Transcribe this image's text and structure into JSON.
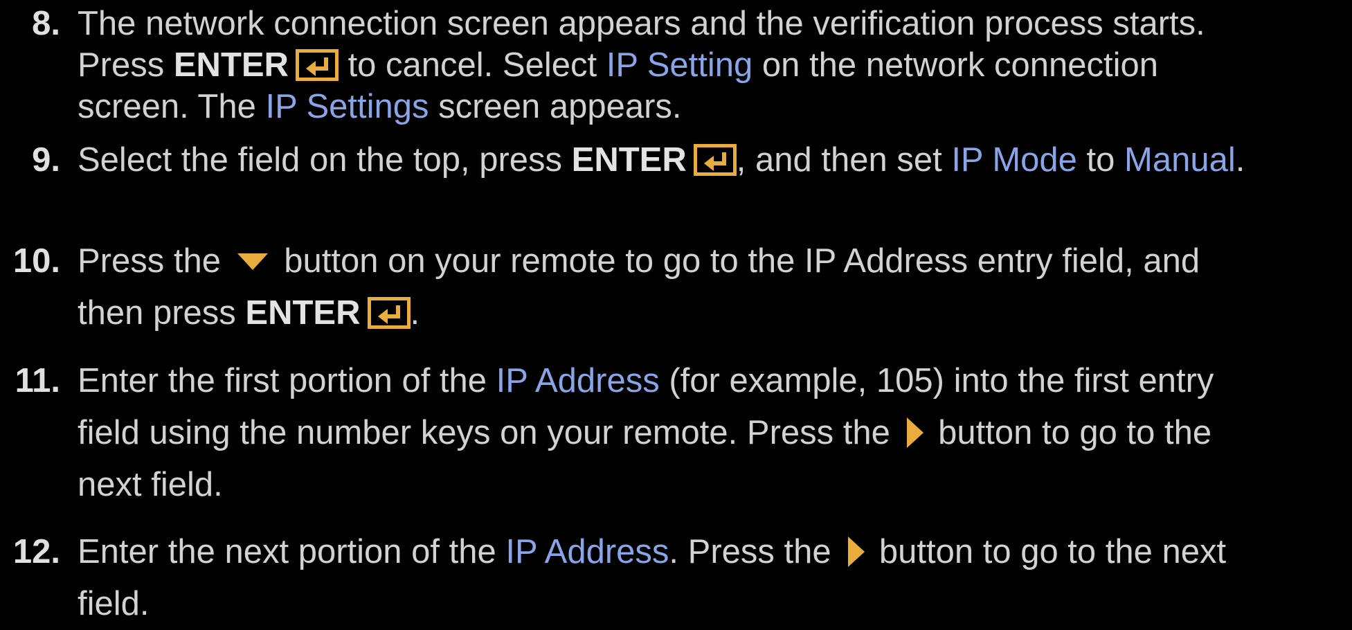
{
  "colors": {
    "background": "#000000",
    "text": "#d2d2d2",
    "highlight": "#8aa4e8",
    "icon": "#e8ad3c"
  },
  "steps": [
    {
      "num": "8.",
      "lines": [
        [
          "The network connection screen appears and the verification process starts."
        ],
        [
          "Press ",
          "ENTER",
          " to cancel. Select ",
          "IP Setting",
          " on the network connection"
        ],
        [
          "screen. The ",
          "IP Settings",
          " screen appears."
        ]
      ]
    },
    {
      "num": "9.",
      "lines": [
        [
          "Select the field on the top, press ",
          "ENTER",
          ", and then set ",
          "IP Mode",
          " to ",
          "Manual",
          "."
        ]
      ]
    },
    {
      "num": "10.",
      "lines": [
        [
          "Press the ",
          " button on your remote to go to the IP Address entry field, and"
        ],
        [
          "then press ",
          "ENTER",
          "."
        ]
      ]
    },
    {
      "num": "11.",
      "lines": [
        [
          "Enter the first portion of the ",
          "IP Address",
          " (for example, 105) into the first entry"
        ],
        [
          "field using the number keys on your remote. Press the ",
          " button to go to the"
        ],
        [
          "next field."
        ]
      ]
    },
    {
      "num": "12.",
      "lines": [
        [
          "Enter the next portion of the ",
          "IP Address",
          ". Press the ",
          " button to go to the next"
        ],
        [
          "field."
        ]
      ]
    }
  ]
}
